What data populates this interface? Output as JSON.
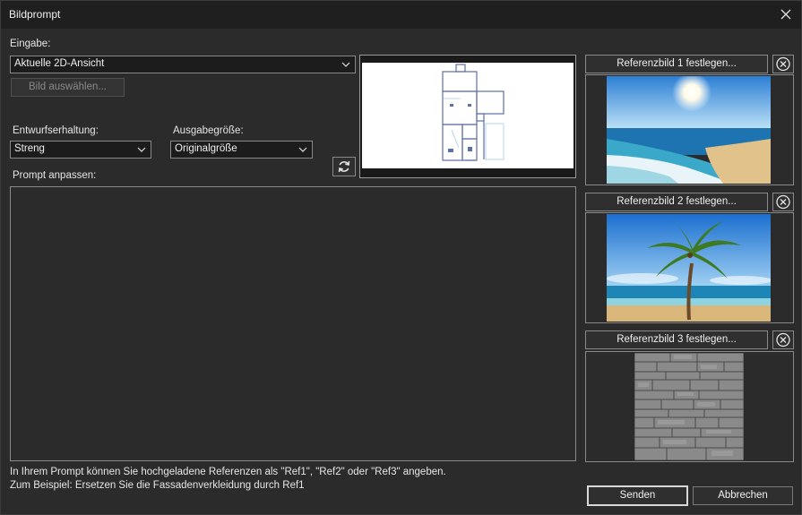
{
  "window": {
    "title": "Bildprompt"
  },
  "input": {
    "label": "Eingabe:",
    "value": "Aktuelle 2D-Ansicht",
    "select_image_label": "Bild auswählen..."
  },
  "design_retention": {
    "label": "Entwurfserhaltung:",
    "value": "Streng"
  },
  "output_size": {
    "label": "Ausgabegröße:",
    "value": "Originalgröße"
  },
  "prompt": {
    "label": "Prompt anpassen:",
    "value": ""
  },
  "hints": {
    "line1": "In Ihrem Prompt können Sie hochgeladene Referenzen als \"Ref1\", \"Ref2\" oder \"Ref3\" angeben.",
    "line2": "Zum Beispiel: Ersetzen Sie die Fassadenverkleidung durch Ref1"
  },
  "references": [
    {
      "label": "Referenzbild 1 festlegen...",
      "image": "beach-sun"
    },
    {
      "label": "Referenzbild 2 festlegen...",
      "image": "palm-tree"
    },
    {
      "label": "Referenzbild 3 festlegen...",
      "image": "stone-wall"
    }
  ],
  "buttons": {
    "send": "Senden",
    "cancel": "Abbrechen"
  },
  "icons": {
    "close": "close-icon",
    "refresh": "refresh-icon",
    "dropdown": "chevron-down-icon",
    "remove": "remove-circle-icon"
  }
}
